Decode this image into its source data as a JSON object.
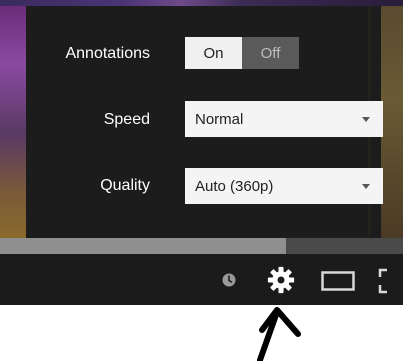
{
  "settings": {
    "annotations": {
      "label": "Annotations",
      "on_label": "On",
      "off_label": "Off",
      "selected": "On"
    },
    "speed": {
      "label": "Speed",
      "value": "Normal"
    },
    "quality": {
      "label": "Quality",
      "value": "Auto (360p)"
    }
  },
  "player": {
    "progress_fraction": 0.71,
    "controls": [
      "watch-later-icon",
      "gear-icon",
      "theater-mode-icon",
      "fullscreen-icon"
    ]
  },
  "colors": {
    "panel": "#1c1c1c",
    "control_bar": "#1b1b1b",
    "select_bg": "#f4f4f4",
    "toggle_on": "#f0f0f0",
    "toggle_off": "#5a5a5a"
  }
}
